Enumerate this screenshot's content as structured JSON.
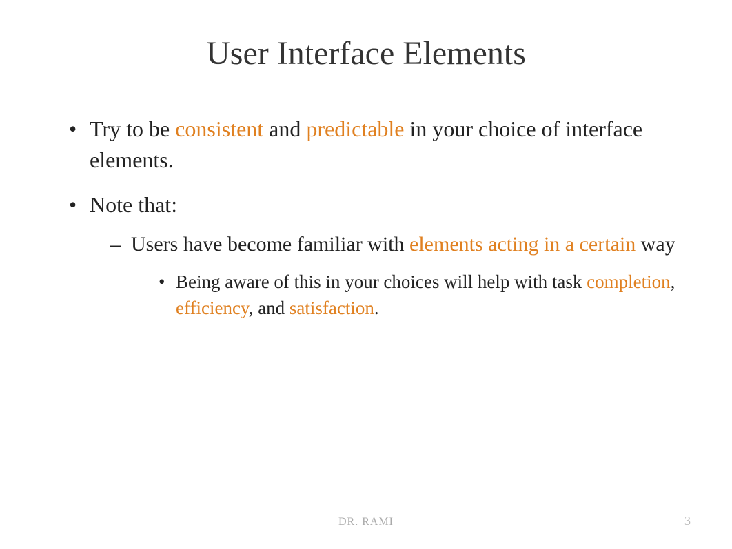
{
  "title": "User Interface Elements",
  "bullets": {
    "b1_pre": "Try to be ",
    "b1_h1": "consistent ",
    "b1_mid": " and ",
    "b1_h2": "predictable ",
    "b1_post": " in your choice of interface elements.",
    "b2": "Note that:",
    "d1_pre": "Users have become familiar  with ",
    "d1_h1": "elements acting in a certain ",
    "d1_post": "way",
    "s1_pre": "Being aware of this in your choices will help with task ",
    "s1_h1": "completion",
    "s1_c1": ", ",
    "s1_h2": "efficiency",
    "s1_c2": ", and ",
    "s1_h3": "satisfaction",
    "s1_post": "."
  },
  "footer": "DR. RAMI",
  "page": "3"
}
